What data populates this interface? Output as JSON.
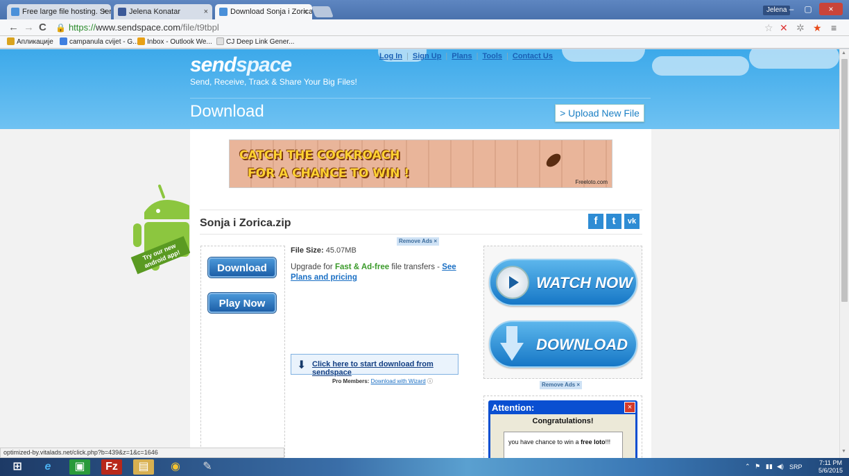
{
  "browser": {
    "tabs": [
      {
        "title": "Free large file hosting. Ser",
        "favicon_color": "#4a90d9"
      },
      {
        "title": "Jelena Konatar",
        "favicon_color": "#3b5998"
      },
      {
        "title": "Download Sonja i Zorica.z",
        "favicon_color": "#4a90d9"
      }
    ],
    "tab_close": "×",
    "user": "Jelena",
    "window_controls": {
      "minimize": "–",
      "restore": "▢",
      "close": "×"
    },
    "url": {
      "scheme": "https://",
      "host": "www.sendspace.com",
      "path": "/file/t9tbpl"
    },
    "bookmarks": [
      {
        "label": "Апликације",
        "icon_color": "#d9a31e"
      },
      {
        "label": "campanula cvijet - G...",
        "icon_color": "#3f7fe0"
      },
      {
        "label": "Inbox - Outlook We...",
        "icon_color": "#e8a015"
      },
      {
        "label": "CJ Deep Link Gener...",
        "icon_color": "#e0e0e0"
      }
    ]
  },
  "page": {
    "logo": {
      "part1": "send",
      "part2": "space"
    },
    "tagline": "Send, Receive, Track & Share Your Big Files!",
    "nav": [
      "Log In",
      "Sign Up",
      "Plans",
      "Tools",
      "Contact Us"
    ],
    "heading": "Download",
    "upload_button": "> Upload New File",
    "android_promo": "Try our new android app!",
    "banner": {
      "line1": "CATCH THE COCKROACH",
      "line2": "FOR A CHANCE TO WIN !",
      "brand": "Freeloto.com"
    },
    "remove_ads": "Remove Ads ×",
    "file_name": "Sonja i Zorica.zip",
    "social": [
      "f",
      "t",
      "vk"
    ],
    "download_button": "Download",
    "play_now_button": "Play Now",
    "file_size_label": "File Size:",
    "file_size_value": "45.07MB",
    "upgrade": {
      "prefix": "Upgrade for",
      "highlight": "Fast & Ad-free",
      "middle": "file transfers -",
      "link": "See Plans and pricing"
    },
    "start_download": "Click here to start download from sendspace",
    "pro_members_label": "Pro Members:",
    "pro_members_link": "Download with Wizard",
    "ad_watch_now": "WATCH NOW",
    "ad_download": "DOWNLOAD",
    "attention": {
      "title": "Attention:",
      "close": "×",
      "congrats": "Congratulations!",
      "msg_prefix": "you have chance to win a",
      "msg_bold": "free loto",
      "msg_suffix": "!!!"
    },
    "status_url": "optimized-by.vitalads.net/click.php?b=439&z=1&c=1646"
  },
  "taskbar": {
    "language": "SRP",
    "time": "7:11 PM",
    "date": "5/6/2015"
  },
  "colors": {
    "header_blue": "#3ca9ea",
    "button_blue": "#1d5fa8",
    "link_blue": "#1a6fc4",
    "accent_green": "#3a9a2a"
  }
}
